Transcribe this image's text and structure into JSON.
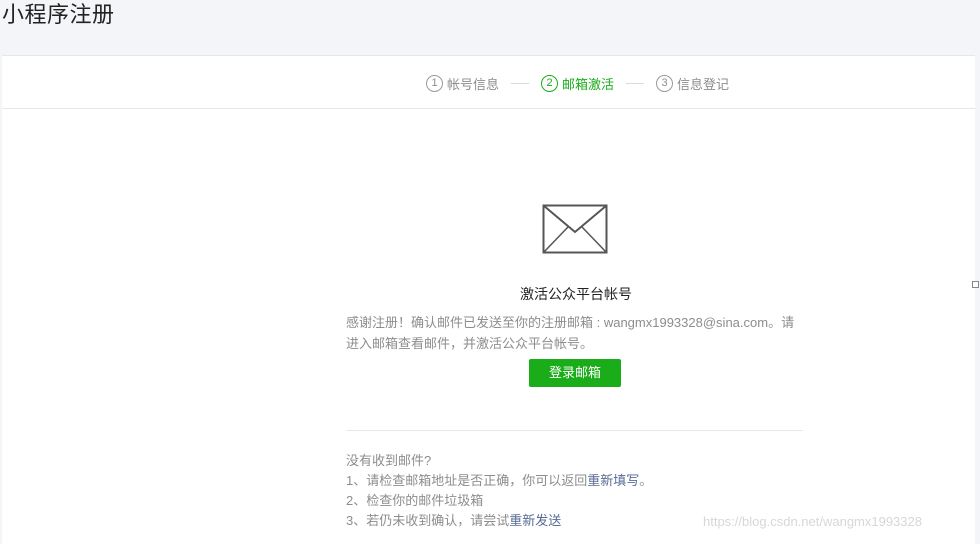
{
  "page_title": "小程序注册",
  "steps": [
    {
      "num": "1",
      "label": "帐号信息",
      "active": false
    },
    {
      "num": "2",
      "label": "邮箱激活",
      "active": true
    },
    {
      "num": "3",
      "label": "信息登记",
      "active": false
    }
  ],
  "main": {
    "icon": "envelope-icon",
    "title": "激活公众平台帐号",
    "description": "感谢注册！确认邮件已发送至你的注册邮箱 : wangmx1993328@sina.com。请进入邮箱查看邮件，并激活公众平台帐号。",
    "login_button": "登录邮箱"
  },
  "help": {
    "heading": "没有收到邮件?",
    "item1_prefix": "1、请检查邮箱地址是否正确，你可以返回",
    "item1_link": "重新填写",
    "item1_suffix": "。",
    "item2": "2、检查你的邮件垃圾箱",
    "item3_prefix": "3、若仍未收到确认，请尝试",
    "item3_link": "重新发送"
  },
  "watermark": "https://blog.csdn.net/wangmx1993328",
  "colors": {
    "accent": "#1aad19",
    "link": "#576b95"
  }
}
